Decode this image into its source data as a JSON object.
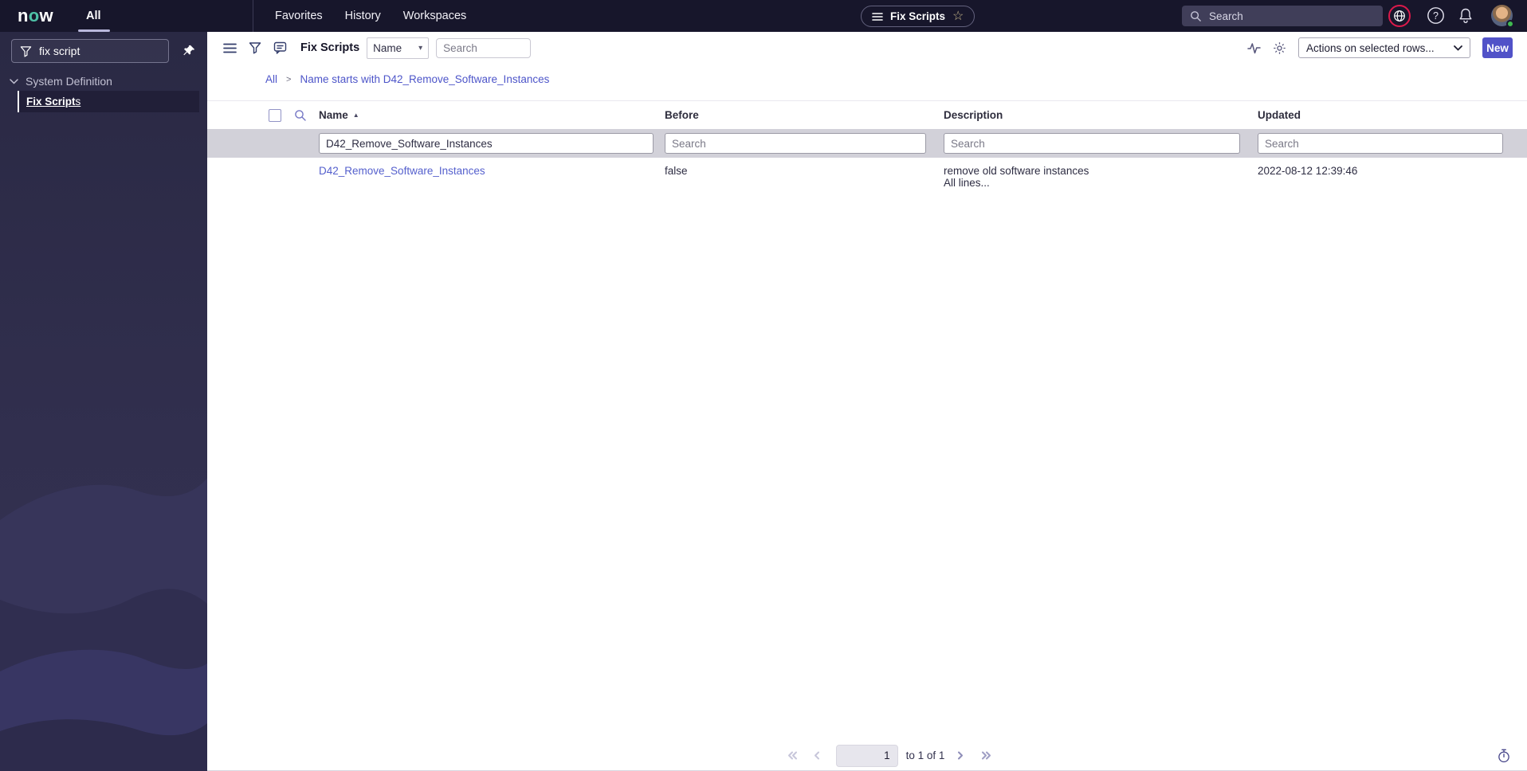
{
  "header": {
    "logo_n": "n",
    "logo_o": "o",
    "logo_w": "w",
    "all_tab": "All",
    "nav": [
      {
        "label": "Favorites"
      },
      {
        "label": "History"
      },
      {
        "label": "Workspaces"
      }
    ],
    "pill_label": "Fix Scripts",
    "search_placeholder_text": "Search"
  },
  "sidebar": {
    "filter_value": "fix script",
    "section_label": "System Definition",
    "item_match": "Fix Script",
    "item_rest": "s"
  },
  "toolbar": {
    "title": "Fix Scripts",
    "field_select_value": "Name",
    "search_placeholder": "Search",
    "actions_value": "Actions on selected rows...",
    "new_button": "New"
  },
  "breadcrumb": {
    "root": "All",
    "separator": ">",
    "current": "Name starts with D42_Remove_Software_Instances"
  },
  "table": {
    "columns": {
      "name": "Name",
      "before": "Before",
      "description": "Description",
      "updated": "Updated"
    },
    "filter": {
      "name_value": "D42_Remove_Software_Instances",
      "before_placeholder": "Search",
      "description_placeholder": "Search",
      "updated_placeholder": "Search"
    },
    "rows": [
      {
        "name": "D42_Remove_Software_Instances",
        "before": "false",
        "description_line1": "remove old software instances",
        "description_line2": "All lines...",
        "updated": "2022-08-12 12:39:46"
      }
    ]
  },
  "pagination": {
    "page_value": "1",
    "range_label": "to 1 of 1"
  },
  "glyphs": {
    "star": "☆",
    "caret": "▾",
    "sort_asc": "▲",
    "question": "?"
  },
  "colors": {
    "header_bg": "#17162b",
    "sidebar_bg_top": "#2a2944",
    "sidebar_bg_bottom": "#343254",
    "logo_accent": "#4ec0a6",
    "link": "#4d55c9",
    "row_link": "#5560cd",
    "primary_button": "#5152c8",
    "alert_ring": "#dc1a4b",
    "filter_row_bg": "#d2d1d9",
    "presence_green": "#3fb94f"
  }
}
